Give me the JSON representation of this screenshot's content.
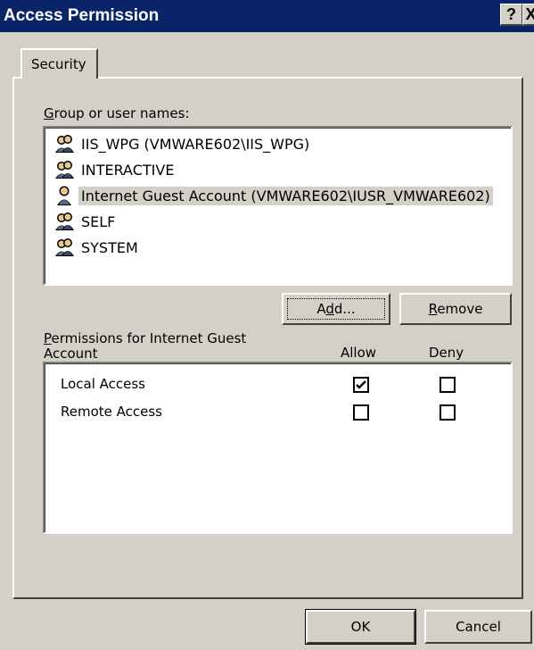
{
  "window": {
    "title": "Access Permission",
    "help_button": "?",
    "close_button": "X"
  },
  "tabs": [
    {
      "label": "Security",
      "selected": true
    }
  ],
  "group_section": {
    "label_accel": "G",
    "label_rest": "roup or user names:",
    "users": [
      {
        "name": "IIS_WPG (VMWARE602\\IIS_WPG)",
        "icon": "group-icon",
        "selected": false
      },
      {
        "name": "INTERACTIVE",
        "icon": "group-icon",
        "selected": false
      },
      {
        "name": "Internet Guest Account (VMWARE602\\IUSR_VMWARE602)",
        "icon": "user-icon",
        "selected": true
      },
      {
        "name": "SELF",
        "icon": "group-icon",
        "selected": false
      },
      {
        "name": "SYSTEM",
        "icon": "group-icon",
        "selected": false
      }
    ]
  },
  "buttons": {
    "add_pre": "A",
    "add_accel": "d",
    "add_post": "d...",
    "remove_accel": "R",
    "remove_rest": "emove",
    "ok": "OK",
    "cancel": "Cancel"
  },
  "permissions": {
    "label_accel": "P",
    "label_line1_rest": "ermissions for Internet Guest",
    "label_line2": "Account",
    "allow_header": "Allow",
    "deny_header": "Deny",
    "rows": [
      {
        "name": "Local Access",
        "allow": true,
        "deny": false
      },
      {
        "name": "Remote Access",
        "allow": false,
        "deny": false
      }
    ]
  },
  "colors": {
    "titlebar": "#0a246a",
    "face": "#d4d0c8",
    "selection": "#d4d0c8"
  }
}
